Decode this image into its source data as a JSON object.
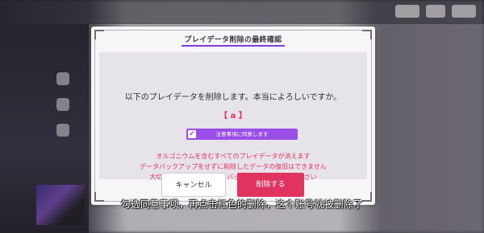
{
  "dialog": {
    "title": "プレイデータ削除の最終確認",
    "question": "以下のプレイデータを削除します。本当によろしいですか。",
    "data_name": "【 a 】",
    "agree_label": "注意事項に同意します",
    "agree_checked": true,
    "warnings": [
      "オルゴニウムを含むすべてのプレイデータが消えます",
      "データバックアップをせずに削除したデータの復旧はできません",
      "大切なデータは必ずデータバックアップを行ってください"
    ],
    "cancel_label": "キャンセル",
    "delete_label": "削除する"
  },
  "subtitle": "勾选同意事项，再点击红色的删除，这个账号就被删除了",
  "colors": {
    "accent_purple": "#9a4ee8",
    "danger_red": "#e0335f"
  }
}
